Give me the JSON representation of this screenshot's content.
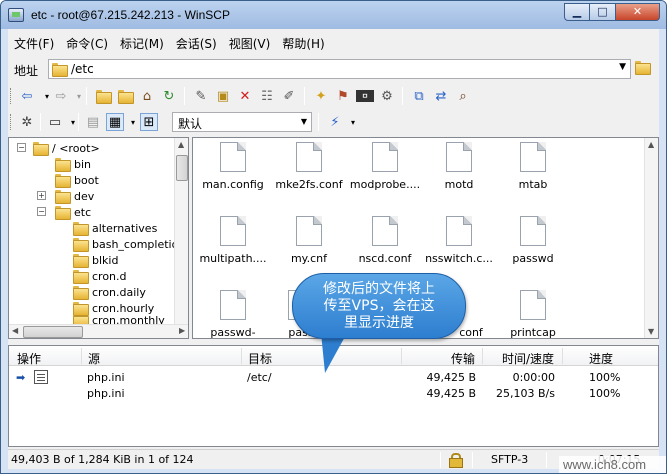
{
  "window": {
    "title": "etc - root@67.215.242.213 - WinSCP",
    "min_glyph": "▁",
    "max_glyph": "□",
    "close_glyph": "✕"
  },
  "menu": [
    "文件(F)",
    "命令(C)",
    "标记(M)",
    "会话(S)",
    "视图(V)",
    "帮助(H)"
  ],
  "address": {
    "label": "地址",
    "value": "/etc"
  },
  "toolbar2": {
    "profile_value": "默认"
  },
  "tree": {
    "root_label": "/ <root>",
    "items": [
      "bin",
      "boot",
      "dev",
      "etc",
      "alternatives",
      "bash_completion",
      "blkid",
      "cron.d",
      "cron.daily",
      "cron.hourly",
      "cron.monthly"
    ]
  },
  "files": [
    "man.config",
    "mke2fs.conf",
    "modprobe....",
    "motd",
    "mtab",
    "multipath....",
    "my.cnf",
    "nscd.conf",
    "nsswitch.c...",
    "passwd",
    "passwd-",
    "pass",
    "conf",
    "printcap"
  ],
  "callout": {
    "line1": "修改后的文件将上",
    "line2": "传至VPS，会在这",
    "line3": "里显示进度"
  },
  "queue": {
    "headers": {
      "op": "操作",
      "source": "源",
      "target": "目标",
      "transferred": "传输",
      "time_speed": "时间/速度",
      "progress": "进度"
    },
    "rows": [
      {
        "source": "php.ini",
        "target": "/etc/",
        "transferred": "49,425 B",
        "time_speed": "0:00:00",
        "progress": "100%"
      },
      {
        "source": "php.ini",
        "target": "",
        "transferred": "49,425 B",
        "time_speed": "25,103 B/s",
        "progress": "100%"
      }
    ]
  },
  "status": {
    "selection": "49,403 B of 1,284 KiB in 1 of 124",
    "protocol": "SFTP-3",
    "time_partial": "0:07:15"
  },
  "watermark": "www.ich8.com",
  "colors": {
    "titlebar": "#bcd3ef",
    "callout": "#3a8ad6",
    "close_button": "#c8452a"
  }
}
